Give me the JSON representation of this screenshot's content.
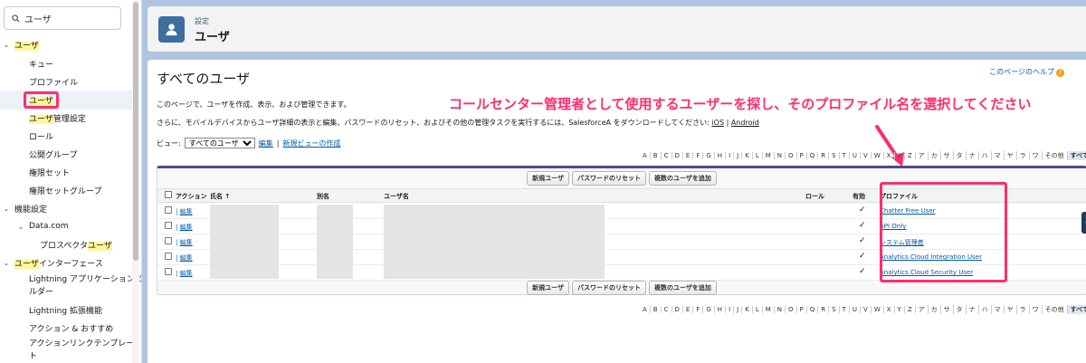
{
  "search": {
    "value": "ユーザ"
  },
  "sidebar": {
    "items": [
      {
        "label": "ユーザ",
        "chev": "⌄",
        "level": 0,
        "hl": "ユーザ",
        "rest": ""
      },
      {
        "label": "キュー",
        "level": 1
      },
      {
        "label": "プロファイル",
        "level": 1
      },
      {
        "label": "ユーザ",
        "level": 1,
        "selected": true
      },
      {
        "label": "ユーザ管理設定",
        "level": 1,
        "hl": "ユーザ",
        "rest": "管理設定"
      },
      {
        "label": "ロール",
        "level": 1
      },
      {
        "label": "公開グループ",
        "level": 1
      },
      {
        "label": "権限セット",
        "level": 1
      },
      {
        "label": "権限セットグループ",
        "level": 1
      },
      {
        "label": "機能設定",
        "chev": "⌄",
        "level": 0
      },
      {
        "label": "Data.com",
        "chev": "⌄",
        "level": 1
      },
      {
        "label": "プロスペクタユーザ",
        "level": 2,
        "pre": "プロスペクタ",
        "hl": "ユーザ"
      },
      {
        "label": "ユーザインターフェース",
        "chev": "⌄",
        "level": 0,
        "hl": "ユーザ",
        "rest": "インターフェース"
      },
      {
        "label": "Lightning アプリケーションビルダー",
        "level": 1,
        "line1": "Lightning アプリケーションビ",
        "line2": "ルダー"
      },
      {
        "label": "Lightning 拡張機能",
        "level": 1
      },
      {
        "label": "アクション & おすすめ",
        "level": 1
      },
      {
        "label": "アクションリンクテンプレート",
        "level": 1,
        "line1": "アクションリンクテンプレー",
        "line2": "ト"
      }
    ]
  },
  "header": {
    "breadcrumb": "設定",
    "title": "ユーザ"
  },
  "page": {
    "title": "すべてのユーザ",
    "help": "このページのヘルプ",
    "description1": "このページで、ユーザを作成、表示、および管理できます。",
    "description2": "さらに、モバイルデバイスからユーザ詳細の表示と編集、パスワードのリセット、およびその他の管理タスクを実行するには、SalesforceA をダウンロードしてください:",
    "ios": "iOS",
    "sep": "|",
    "android": "Android",
    "annotation": "コールセンター管理者として使用するユーザーを探し、そのプロファイル名を選択してください"
  },
  "view": {
    "label": "ビュー:",
    "selected": "すべてのユーザ",
    "edit": "編集",
    "sep": "|",
    "new_view": "新規ビューの作成"
  },
  "alphabet": [
    "A",
    "B",
    "C",
    "D",
    "E",
    "F",
    "G",
    "H",
    "I",
    "J",
    "K",
    "L",
    "M",
    "N",
    "O",
    "P",
    "Q",
    "R",
    "S",
    "T",
    "U",
    "V",
    "W",
    "X",
    "Y",
    "Z",
    "ア",
    "カ",
    "サ",
    "タ",
    "ナ",
    "ハ",
    "マ",
    "ヤ",
    "ラ",
    "ワ",
    "その他",
    "すべて"
  ],
  "buttons": {
    "new_user": "新規ユーザ",
    "reset_password": "パスワードのリセット",
    "add_multiple": "複数のユーザを追加"
  },
  "table": {
    "headers": {
      "action": "アクション",
      "name": "氏名 ↑",
      "alias": "別名",
      "username": "ユーザ名",
      "role": "ロール",
      "active": "有効",
      "profile": "プロファイル"
    },
    "rows": [
      {
        "edit": "編集",
        "active": "✓",
        "profile": "Chatter Free User"
      },
      {
        "edit": "編集",
        "active": "✓",
        "profile": "API Only"
      },
      {
        "edit": "編集",
        "active": "✓",
        "profile": "システム管理者"
      },
      {
        "edit": "編集",
        "active": "✓",
        "profile": "Analytics Cloud Integration User"
      },
      {
        "edit": "編集",
        "active": "✓",
        "profile": "Analytics Cloud Security User"
      }
    ]
  },
  "colors": {
    "accent_pink": "#ff2d6f",
    "brand_blue": "#3c6ea0",
    "link": "#015ba7",
    "highlight": "#fff59a"
  }
}
